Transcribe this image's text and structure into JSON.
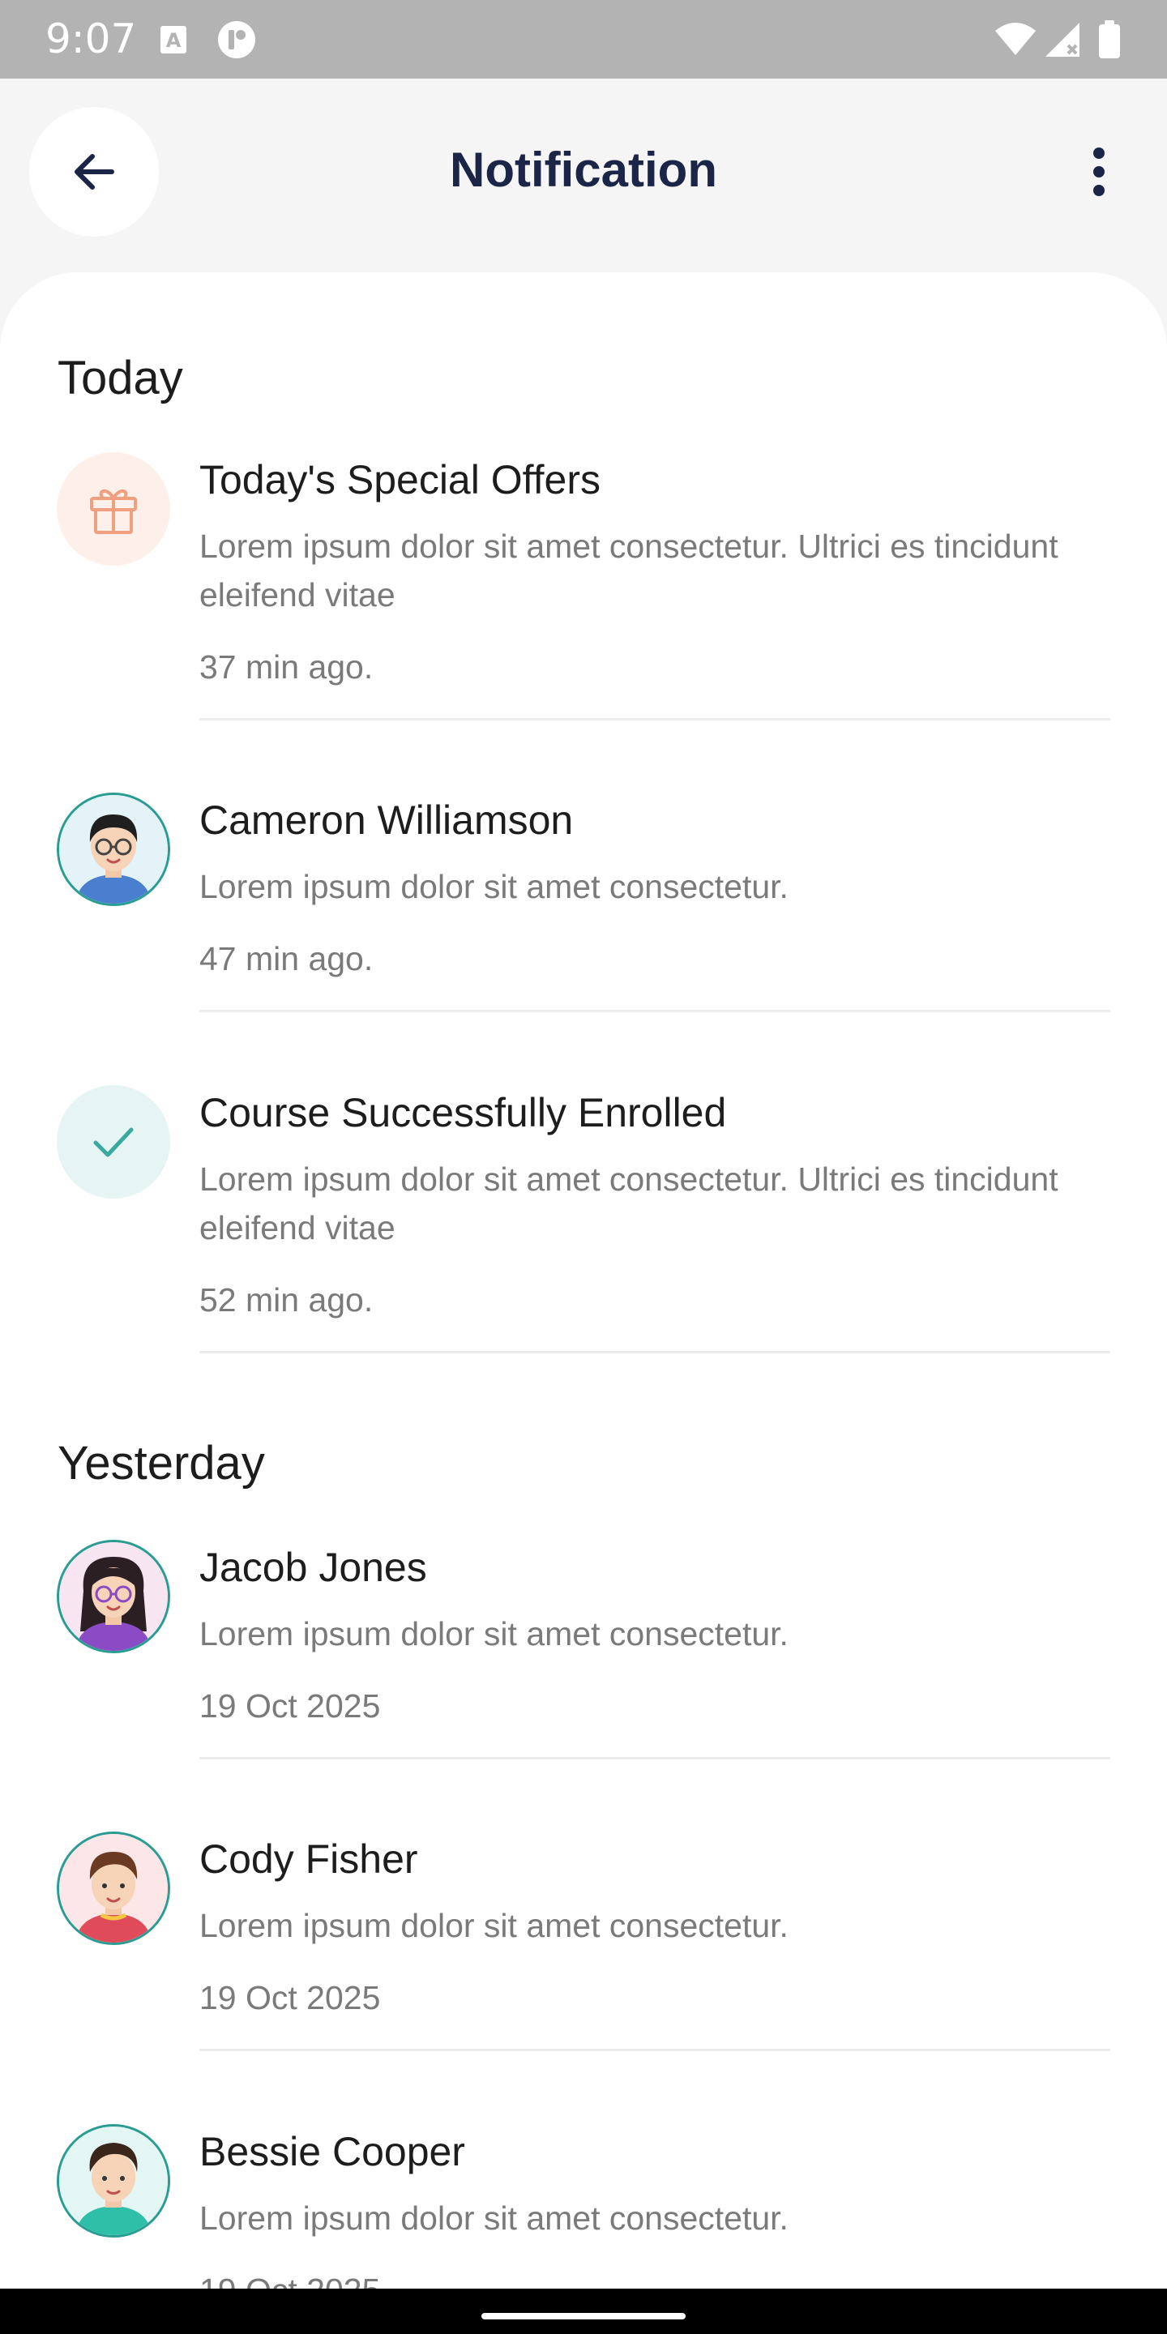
{
  "status_bar": {
    "time": "9:07"
  },
  "header": {
    "title": "Notification"
  },
  "sections": {
    "today_label": "Today",
    "yesterday_label": "Yesterday"
  },
  "notifications": [
    {
      "title": "Today's Special Offers",
      "body": "Lorem ipsum dolor sit amet consectetur. Ultrici es tincidunt eleifend vitae",
      "time": "37 min ago.",
      "icon": "gift-icon"
    },
    {
      "title": "Cameron Williamson",
      "body": "Lorem ipsum dolor sit amet consectetur.",
      "time": "47 min ago.",
      "icon": "avatar"
    },
    {
      "title": "Course Successfully Enrolled",
      "body": "Lorem ipsum dolor sit amet consectetur. Ultrici es tincidunt eleifend vitae",
      "time": "52 min ago.",
      "icon": "check-icon"
    },
    {
      "title": "Jacob Jones",
      "body": "Lorem ipsum dolor sit amet consectetur.",
      "time": "19 Oct 2025",
      "icon": "avatar"
    },
    {
      "title": "Cody Fisher",
      "body": "Lorem ipsum dolor sit amet consectetur.",
      "time": "19 Oct 2025",
      "icon": "avatar"
    },
    {
      "title": "Bessie Cooper",
      "body": "Lorem ipsum dolor sit amet consectetur.",
      "time": "19 Oct 2025",
      "icon": "avatar"
    }
  ],
  "colors": {
    "title_navy": "#1a2547",
    "gift_bg": "#fdf0ea",
    "gift_accent": "#f0a07e",
    "check_bg": "#e6f4f3",
    "check_accent": "#3aa99f",
    "avatar_ring": "#2a9d93"
  }
}
